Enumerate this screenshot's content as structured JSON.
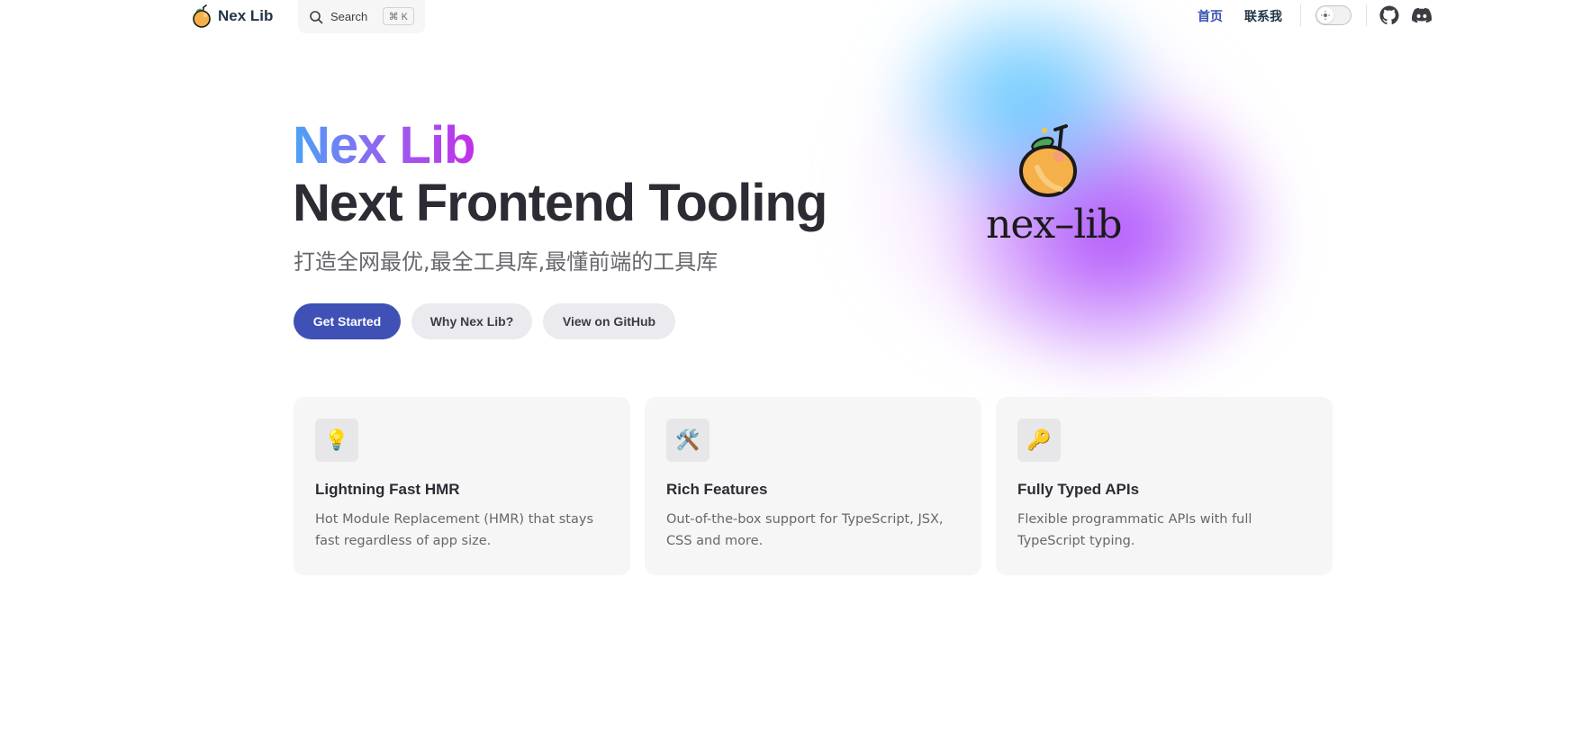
{
  "nav": {
    "title": "Nex Lib",
    "search_placeholder": "Search",
    "search_shortcut": "⌘ K",
    "links": [
      {
        "label": "首页",
        "active": true
      },
      {
        "label": "联系我",
        "active": false
      }
    ],
    "appearance_toggle": "light",
    "social": [
      "github-icon",
      "discord-icon"
    ],
    "accent": "#3451b2"
  },
  "hero": {
    "name": "Nex Lib",
    "text": "Next Frontend Tooling",
    "tagline": "打造全网最优,最全工具库,最懂前端的工具库",
    "actions": [
      {
        "label": "Get Started",
        "theme": "brand"
      },
      {
        "label": "Why Nex Lib?",
        "theme": "alt"
      },
      {
        "label": "View on GitHub",
        "theme": "alt"
      }
    ],
    "logo_word": "nex–lib",
    "brand_color": "#3f51b5"
  },
  "features": [
    {
      "icon": "💡",
      "title": "Lightning Fast HMR",
      "details": "Hot Module Replacement (HMR) that stays fast regardless of app size."
    },
    {
      "icon": "🛠️",
      "title": "Rich Features",
      "details": "Out-of-the-box support for TypeScript, JSX, CSS and more."
    },
    {
      "icon": "🔑",
      "title": "Fully Typed APIs",
      "details": "Flexible programmatic APIs with full TypeScript typing."
    }
  ]
}
